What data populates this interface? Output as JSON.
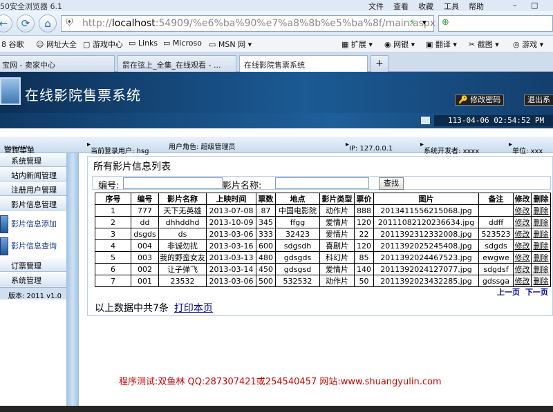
{
  "browser": {
    "title": "50安全浏览器 6.1",
    "menu": [
      "文件",
      "查看",
      "收藏",
      "工具",
      "帮助"
    ],
    "url_prefix": "http://",
    "url_host": "localhost",
    "url_rest": ":54909/%e6%ba%90%e7%a8%8b%e5%ba%8f/main.aspx",
    "favorites": [
      "谷歌",
      "网址大全",
      "游戏中心",
      "Links",
      "Microso",
      "MSN 网"
    ],
    "tools": [
      "扩展",
      "网银",
      "翻译",
      "截图",
      "游戏"
    ],
    "tabs": [
      "宝网 - 卖家中心",
      "箭在弦上_全集_在线观看 - ...",
      "在线影院售票系统"
    ]
  },
  "app": {
    "title": "在线影院售票系统",
    "change_password": "修改密码",
    "logout": "退出系",
    "clock": "113-04-06 02:54:52 PM"
  },
  "infobar": {
    "menu_label": "管理菜单",
    "menu_sub": "MAIN MENU",
    "user": "当前登录用户: hsg",
    "role": "用户角色: 超级管理员",
    "ip": "IP: 127.0.0.1",
    "developer": "系统开发者: xxxx",
    "unit": "单位: xxx"
  },
  "sidebar": {
    "items": [
      "系统管理",
      "站内新闻管理",
      "注册用户管理",
      "影片信息管理"
    ],
    "subs": [
      "影片信息添加",
      "影片信息查询"
    ],
    "items2": [
      "订票管理",
      "系统管理"
    ],
    "version": "版本: 2011 v1.0"
  },
  "main": {
    "list_title": "所有影片信息列表",
    "search_code_label": "编号:",
    "search_name_label": "影片名称:",
    "search_button": "查找",
    "headers": [
      "序号",
      "编号",
      "影片名称",
      "上映时间",
      "票数",
      "地点",
      "影片类型",
      "票价",
      "图片",
      "备注",
      "修改",
      "删除"
    ],
    "rows": [
      [
        "1",
        "777",
        "天下无英雄",
        "2013-07-08",
        "87",
        "中国电影院",
        "动作片",
        "888",
        "2013411556215068.jpg",
        "",
        "修改",
        "删除"
      ],
      [
        "2",
        "dd",
        "dhhddhd",
        "2013-10-09",
        "345",
        "ffgg",
        "爱情片",
        "120",
        "20111082120236634.jpg",
        "ddff",
        "修改",
        "删除"
      ],
      [
        "3",
        "dsgds",
        "ds",
        "2013-03-06",
        "333",
        "32423",
        "爱情片",
        "22",
        "2011392312332008.jpg",
        "523523",
        "修改",
        "删除"
      ],
      [
        "4",
        "004",
        "非诚勿扰",
        "2013-03-16",
        "600",
        "sdgsdh",
        "喜剧片",
        "120",
        "2011392025245408.jpg",
        "sdgds",
        "修改",
        "删除"
      ],
      [
        "5",
        "003",
        "我的野蛮女友",
        "2013-03-13",
        "480",
        "gdsgds",
        "科幻片",
        "85",
        "2011392024467523.jpg",
        "ewgwe",
        "修改",
        "删除"
      ],
      [
        "6",
        "002",
        "让子弹飞",
        "2013-03-14",
        "450",
        "gdsgsd",
        "爱情片",
        "140",
        "2011392024127077.jpg",
        "sdgdsf",
        "修改",
        "删除"
      ],
      [
        "7",
        "001",
        "23532",
        "2013-03-06",
        "500",
        "532532",
        "动作片",
        "50",
        "2011392023432285.jpg",
        "gdssga",
        "修改",
        "删除"
      ]
    ],
    "prev_page": "上一页",
    "next_page": "下一页",
    "summary": "以上数据中共7条",
    "print_link": "打印本页"
  },
  "watermark": "程序测试:双鱼林 QQ:287307421或254540457 网站:www.shuangyulin.com"
}
